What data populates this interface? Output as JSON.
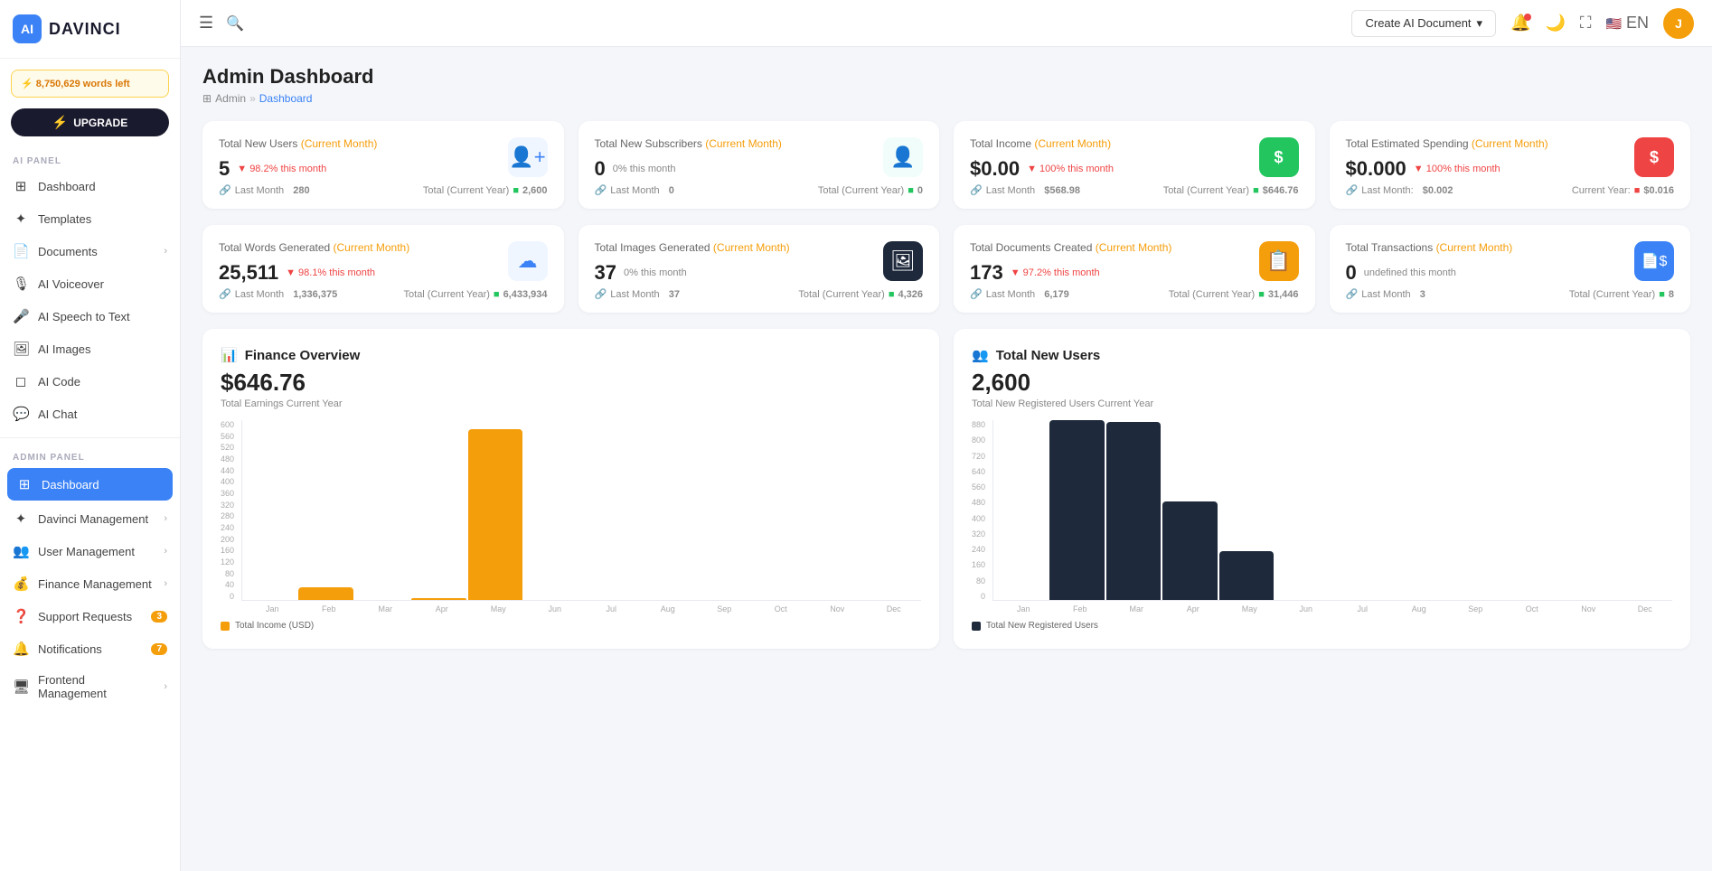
{
  "sidebar": {
    "logo": "DAVINCI",
    "words_left": "8,750,629",
    "words_label": "words left",
    "upgrade_label": "UPGRADE",
    "ai_panel_label": "AI PANEL",
    "admin_panel_label": "ADMIN PANEL",
    "ai_items": [
      {
        "id": "dashboard",
        "label": "Dashboard",
        "icon": "⊞"
      },
      {
        "id": "templates",
        "label": "Templates",
        "icon": "✦"
      },
      {
        "id": "documents",
        "label": "Documents",
        "icon": "📄",
        "arrow": true
      },
      {
        "id": "ai-voiceover",
        "label": "AI Voiceover",
        "icon": "🎙"
      },
      {
        "id": "ai-speech",
        "label": "AI Speech to Text",
        "icon": "🎤"
      },
      {
        "id": "ai-images",
        "label": "AI Images",
        "icon": "🖼"
      },
      {
        "id": "ai-code",
        "label": "AI Code",
        "icon": "◻"
      },
      {
        "id": "ai-chat",
        "label": "AI Chat",
        "icon": "💬"
      }
    ],
    "admin_items": [
      {
        "id": "admin-dashboard",
        "label": "Dashboard",
        "icon": "⊞",
        "active": true
      },
      {
        "id": "davinci-mgmt",
        "label": "Davinci Management",
        "icon": "✦",
        "arrow": true
      },
      {
        "id": "user-mgmt",
        "label": "User Management",
        "icon": "👥",
        "arrow": true
      },
      {
        "id": "finance-mgmt",
        "label": "Finance Management",
        "icon": "💰",
        "arrow": true
      },
      {
        "id": "support-req",
        "label": "Support Requests",
        "icon": "❓",
        "badge": "3",
        "badge_color": "orange"
      },
      {
        "id": "notifications",
        "label": "Notifications",
        "icon": "🔔",
        "badge": "7",
        "badge_color": "orange"
      },
      {
        "id": "frontend-mgmt",
        "label": "Frontend Management",
        "icon": "🖥",
        "arrow": true
      }
    ]
  },
  "topbar": {
    "create_doc_label": "Create AI Document",
    "lang": "EN"
  },
  "page": {
    "title": "Admin Dashboard",
    "breadcrumb_parent": "Admin",
    "breadcrumb_current": "Dashboard"
  },
  "stat_cards": [
    {
      "id": "new-users",
      "title": "Total New Users",
      "period": "(Current Month)",
      "value": "5",
      "pct": "98.2% this month",
      "pct_dir": "down",
      "last_month_label": "Last Month",
      "last_month_val": "280",
      "total_label": "Total (Current Year)",
      "total_val": "2,600",
      "icon": "👤",
      "icon_style": "blue"
    },
    {
      "id": "new-subscribers",
      "title": "Total New Subscribers",
      "period": "(Current Month)",
      "value": "0",
      "pct": "0% this month",
      "pct_dir": "neutral",
      "last_month_label": "Last Month",
      "last_month_val": "0",
      "total_label": "Total (Current Year)",
      "total_val": "0",
      "icon": "👤",
      "icon_style": "teal"
    },
    {
      "id": "total-income",
      "title": "Total Income",
      "period": "(Current Month)",
      "value": "$0.00",
      "pct": "100% this month",
      "pct_dir": "down",
      "last_month_label": "Last Month",
      "last_month_val": "$568.98",
      "total_label": "Total (Current Year)",
      "total_val": "$646.76",
      "icon": "$",
      "icon_style": "green"
    },
    {
      "id": "estimated-spending",
      "title": "Total Estimated Spending",
      "period": "(Current Month)",
      "value": "$0.000",
      "pct": "100% this month",
      "pct_dir": "down",
      "last_month_label": "Last Month:",
      "last_month_val": "$0.002",
      "total_label": "Current Year:",
      "total_val": "$0.016",
      "icon": "$",
      "icon_style": "red"
    },
    {
      "id": "words-generated",
      "title": "Total Words Generated",
      "period": "(Current Month)",
      "value": "25,511",
      "pct": "98.1% this month",
      "pct_dir": "down",
      "last_month_label": "Last Month",
      "last_month_val": "1,336,375",
      "total_label": "Total (Current Year)",
      "total_val": "6,433,934",
      "icon": "☁",
      "icon_style": "blue"
    },
    {
      "id": "images-generated",
      "title": "Total Images Generated",
      "period": "(Current Month)",
      "value": "37",
      "pct": "0% this month",
      "pct_dir": "neutral",
      "last_month_label": "Last Month",
      "last_month_val": "37",
      "total_label": "Total (Current Year)",
      "total_val": "4,326",
      "icon": "🖼",
      "icon_style": "dark"
    },
    {
      "id": "docs-created",
      "title": "Total Documents Created",
      "period": "(Current Month)",
      "value": "173",
      "pct": "97.2% this month",
      "pct_dir": "down",
      "last_month_label": "Last Month",
      "last_month_val": "6,179",
      "total_label": "Total (Current Year)",
      "total_val": "31,446",
      "icon": "📋",
      "icon_style": "orange"
    },
    {
      "id": "transactions",
      "title": "Total Transactions",
      "period": "(Current Month)",
      "value": "0",
      "pct": "undefined this month",
      "pct_dir": "neutral",
      "last_month_label": "Last Month",
      "last_month_val": "3",
      "total_label": "Total (Current Year)",
      "total_val": "8",
      "icon": "📄",
      "icon_style": "blue"
    }
  ],
  "finance_chart": {
    "title": "Finance Overview",
    "icon": "📊",
    "amount": "$646.76",
    "sub": "Total Earnings Current Year",
    "legend": "Total Income (USD)",
    "months": [
      "Jan",
      "Feb",
      "Mar",
      "Apr",
      "May",
      "Jun",
      "Jul",
      "Aug",
      "Sep",
      "Oct",
      "Nov",
      "Dec"
    ],
    "values": [
      0,
      42,
      0,
      5,
      570,
      0,
      0,
      0,
      0,
      0,
      0,
      0
    ],
    "max": 600
  },
  "users_chart": {
    "title": "Total New Users",
    "icon": "👥",
    "amount": "2,600",
    "sub": "Total New Registered Users Current Year",
    "legend": "Total New Registered Users",
    "months": [
      "Jan",
      "Feb",
      "Mar",
      "Apr",
      "May",
      "Jun",
      "Jul",
      "Aug",
      "Sep",
      "Oct",
      "Nov",
      "Dec"
    ],
    "values": [
      0,
      880,
      870,
      480,
      240,
      0,
      0,
      0,
      0,
      0,
      0,
      0
    ],
    "max": 880
  }
}
